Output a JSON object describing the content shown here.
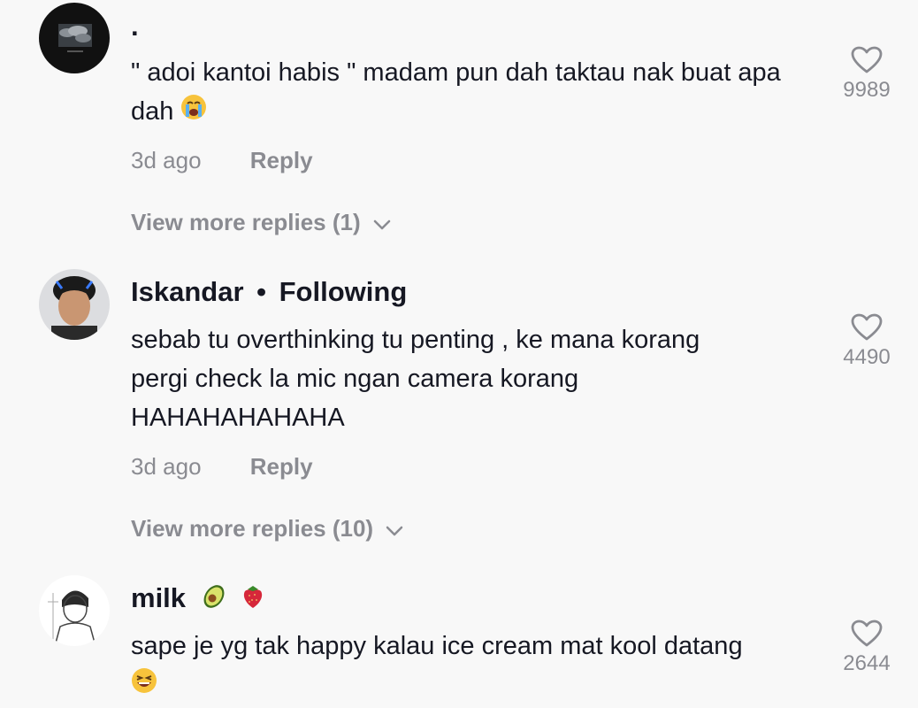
{
  "comments": [
    {
      "username": ".",
      "text": "\" adoi kantoi habis \" madam pun dah taktau nak buat apa dah",
      "emoji": "loudly-crying-face",
      "time": "3d ago",
      "reply_label": "Reply",
      "likes": "9989",
      "view_more": "View more replies (1)"
    },
    {
      "username": "Iskandar",
      "separator": "•",
      "following": "Following",
      "text_lines": [
        "sebab tu overthinking tu penting , ke mana korang",
        "pergi check la mic ngan camera korang",
        "HAHAHAHAHAHA"
      ],
      "time": "3d ago",
      "reply_label": "Reply",
      "likes": "4490",
      "view_more": "View more replies (10)"
    },
    {
      "username": "milk",
      "username_emojis": [
        "avocado",
        "strawberry"
      ],
      "text": "sape je yg tak happy kalau ice cream mat kool datang",
      "emoji": "grinning-squinting-face",
      "likes": "2644"
    }
  ],
  "icons": {
    "like": "heart-outline-icon",
    "expand": "chevron-down-icon"
  },
  "colors": {
    "background": "#f8f8f8",
    "primary_text": "#161823",
    "secondary_text": "#8a8b91"
  }
}
